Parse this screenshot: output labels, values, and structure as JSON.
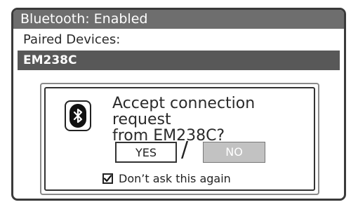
{
  "header": {
    "title": "Bluetooth: Enabled"
  },
  "paired": {
    "label": "Paired Devices:",
    "devices": [
      {
        "name": "EM238C",
        "selected": true
      }
    ]
  },
  "dialog": {
    "icon": "bluetooth-icon",
    "message_line1": "Accept connection request",
    "message_line2": "from EM238C?",
    "yes_label": "YES",
    "separator": "/",
    "no_label": "NO",
    "no_disabled": true,
    "checkbox_label": "Don’t ask this again",
    "checkbox_checked": true
  },
  "colors": {
    "title_bar": "#6e6e6e",
    "selected_row": "#585858",
    "disabled_button": "#c2c2c2",
    "frame": "#3a3a3a"
  }
}
